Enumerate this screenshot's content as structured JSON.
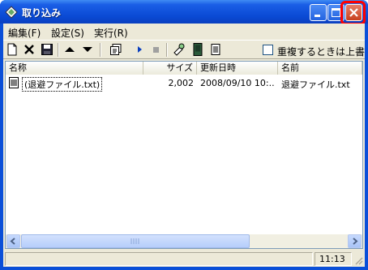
{
  "window": {
    "title": "取り込み",
    "colors": {
      "titlebar": "#0a4ad4",
      "close_highlight": "#ff0000",
      "client": "#ece9d8"
    }
  },
  "menu": [
    {
      "label": "編集(F)"
    },
    {
      "label": "設定(S)"
    },
    {
      "label": "実行(R)"
    }
  ],
  "toolbar": {
    "icons": [
      "new-file-icon",
      "delete-icon",
      "save-icon",
      "move-up-icon",
      "move-down-icon",
      "properties-icon",
      "play-icon",
      "stop-icon",
      "tools-icon",
      "device-icon",
      "notes-icon"
    ],
    "checkbox_label": "重複するときは上書き",
    "checkbox_checked": false
  },
  "list": {
    "columns": [
      "名称",
      "サイズ",
      "更新日時",
      "名前"
    ],
    "rows": [
      {
        "name": "(退避ファイル.txt)",
        "size": "2,002",
        "modified": "2008/09/10 10:...",
        "filename": "退避ファイル.txt"
      }
    ]
  },
  "status": {
    "time": "11:13"
  }
}
